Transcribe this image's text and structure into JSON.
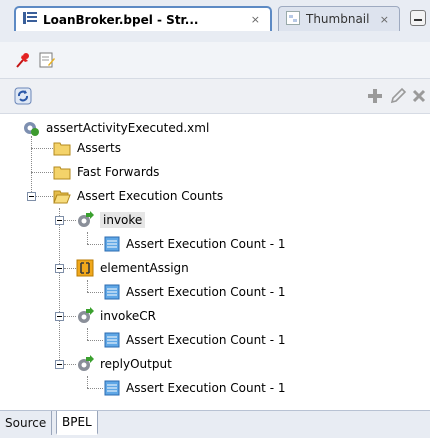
{
  "tabs": [
    {
      "label": "LoanBroker.bpel - Str...",
      "active": true,
      "close": "×"
    },
    {
      "label": "Thumbnail",
      "active": false,
      "close": "×"
    }
  ],
  "tree": {
    "root": "assertActivityExecuted.xml",
    "asserts": "Asserts",
    "fast_forwards": "Fast Forwards",
    "execution_counts": "Assert Execution Counts",
    "activities": [
      {
        "name": "invoke",
        "child": "Assert Execution Count - 1"
      },
      {
        "name": "elementAssign",
        "child": "Assert Execution Count - 1"
      },
      {
        "name": "invokeCR",
        "child": "Assert Execution Count - 1"
      },
      {
        "name": "replyOutput",
        "child": "Assert Execution Count - 1"
      }
    ]
  },
  "bottom_tabs": [
    {
      "label": "Source"
    },
    {
      "label": "BPEL",
      "active": true
    }
  ],
  "colors": {
    "folder": "#f4d36a",
    "accent": "#5d8ac4"
  },
  "icons": [
    "structure-icon",
    "thumbnail-icon",
    "pin-icon",
    "edit-icon",
    "refresh-icon",
    "add-icon",
    "edit-pencil-icon",
    "delete-icon",
    "gear-file-icon",
    "folder-icon",
    "invoke-icon",
    "assign-icon",
    "assert-count-icon"
  ]
}
